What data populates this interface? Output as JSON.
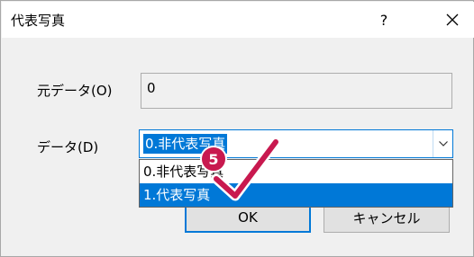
{
  "window": {
    "title": "代表写真",
    "help_label": "?"
  },
  "fields": {
    "original_label": "元データ(O)",
    "original_value": "0",
    "data_label": "データ(D)",
    "data_selected": "0.非代表写真"
  },
  "dropdown": {
    "options": [
      "0.非代表写真",
      "1.代表写真"
    ],
    "highlighted_index": 1
  },
  "buttons": {
    "ok": "OK",
    "cancel": "キャンセル"
  },
  "step_badge": "5",
  "colors": {
    "selection": "#0078d7",
    "badge": "#c8194f"
  }
}
